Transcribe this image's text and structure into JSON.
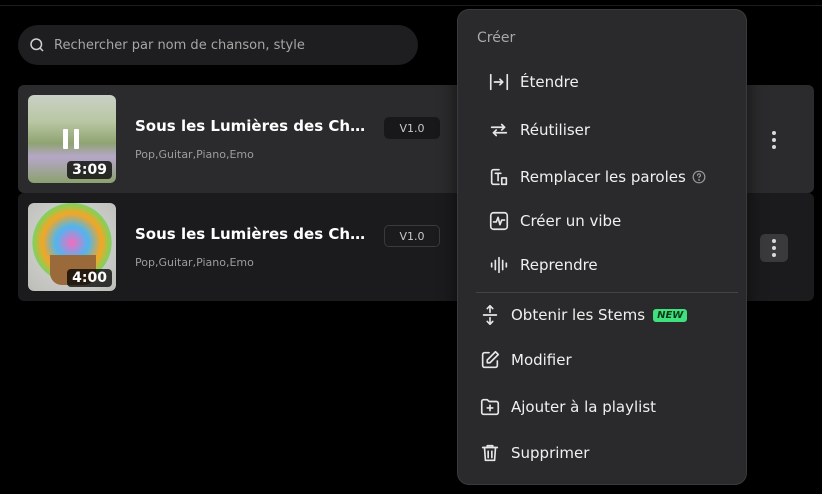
{
  "search": {
    "placeholder": "Rechercher par nom de chanson, style"
  },
  "songs": [
    {
      "title": "Sous les Lumières des Champs",
      "tags": "Pop,Guitar,Piano,Emo",
      "version": "V1.0",
      "duration": "3:09"
    },
    {
      "title": "Sous les Lumières des Champs",
      "tags": "Pop,Guitar,Piano,Emo",
      "version": "V1.0",
      "duration": "4:00"
    }
  ],
  "menu": {
    "heading": "Créer",
    "create_items": [
      {
        "label": "Étendre",
        "icon": "extend-icon"
      },
      {
        "label": "Réutiliser",
        "icon": "reuse-icon"
      },
      {
        "label": "Remplacer les paroles",
        "icon": "replace-lyrics-icon"
      },
      {
        "label": "Créer un vibe",
        "icon": "vibe-icon"
      },
      {
        "label": "Reprendre",
        "icon": "cover-icon"
      }
    ],
    "other_items": [
      {
        "label": "Obtenir les Stems",
        "icon": "stems-icon",
        "badge": "NEW"
      },
      {
        "label": "Modifier",
        "icon": "edit-icon"
      },
      {
        "label": "Ajouter à la playlist",
        "icon": "add-playlist-icon"
      },
      {
        "label": "Supprimer",
        "icon": "trash-icon"
      }
    ]
  },
  "colors": {
    "badge": "#3fe07d",
    "menu_bg": "#2a2a2c",
    "row_active": "#2b2b2d"
  }
}
